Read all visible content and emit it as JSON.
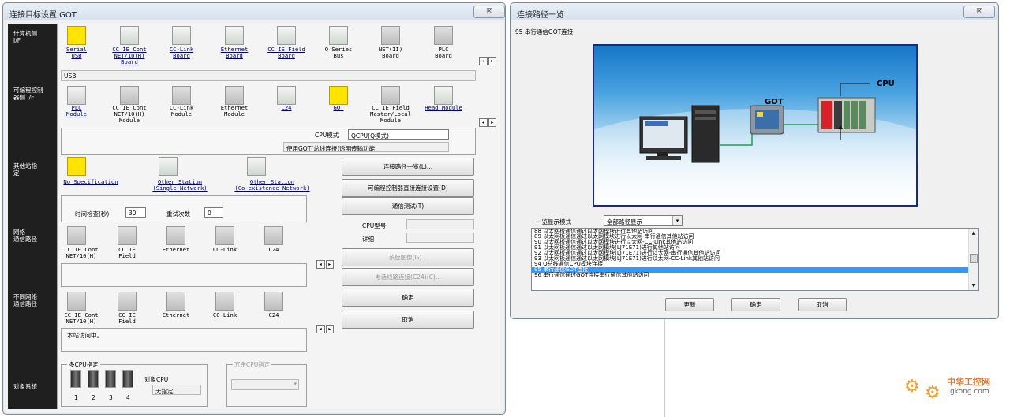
{
  "left_window": {
    "title": "连接目标设置 GOT",
    "close": "☒",
    "sections": {
      "computer_if": "计算机侧\nI/F",
      "plc_if": "可编程控制\n器侧 I/F",
      "other_station": "其他站指\n定",
      "network_route": "网络\n通信路径",
      "diff_network_route": "不同网络\n通信路径",
      "target_system": "对象系统"
    },
    "computer_if_items": [
      "Serial\nUSB",
      "CC IE Cont\nNET/10(H)\nBoard",
      "CC-Link\nBoard",
      "Ethernet\nBoard",
      "CC IE Field\nBoard",
      "Q Series\nBus",
      "NET(II)\nBoard",
      "PLC\nBoard"
    ],
    "computer_if_value": "USB",
    "plc_if_items": [
      "PLC\nModule",
      "CC IE Cont\nNET/10(H)\nModule",
      "CC-Link\nModule",
      "Ethernet\nModule",
      "C24",
      "GOT",
      "CC IE Field\nMaster/Local\nModule",
      "Head Module"
    ],
    "cpu_mode_label": "CPU模式",
    "cpu_mode_value": "QCPU(Q模式)",
    "transfer_text": "使用GOT(总线连接)透明传输功能",
    "other_station_items": [
      "No Specification",
      "Other Station\n(Single Network)",
      "Other Station\n(Co-existence Network)"
    ],
    "timeout_label": "时间检查(秒)",
    "timeout_value": "30",
    "retry_label": "重试次数",
    "retry_value": "0",
    "network_items": [
      "CC IE Cont\nNET/10(H)",
      "CC IE\nField",
      "Ethernet",
      "CC-Link",
      "C24"
    ],
    "diff_network_items": [
      "CC IE Cont\nNET/10(H)",
      "CC IE\nField",
      "Ethernet",
      "CC-Link",
      "C24"
    ],
    "status_text": "本站访问中。",
    "buttons": {
      "route_list": "连接路径一览(L)...",
      "plc_direct": "可编程控制器直接连接设置(D)",
      "comm_test": "通信测试(T)",
      "system_image": "系统图像(G)...",
      "phone_line": "电话线路连接(C24)(C)...",
      "ok": "确定",
      "cancel": "取消"
    },
    "cpu_type_label": "CPU型号",
    "detail_label": "详细",
    "multi_cpu_label": "多CPU指定",
    "cpu_numbers": [
      "1",
      "2",
      "3",
      "4"
    ],
    "target_cpu_label": "对象CPU",
    "target_cpu_value": "无指定",
    "redundant_label": "冗余CPU指定"
  },
  "right_window": {
    "title": "连接路径一览",
    "close": "☒",
    "selected_route": "95 串行通信GOT连接",
    "diagram": {
      "got_label": "GOT",
      "cpu_label": "CPU"
    },
    "display_mode_label": "一览显示模式",
    "display_mode_value": "全部路径显示",
    "routes": [
      "88 以太网板通信通过以太网模块进行其他站访问",
      "89 以太网板通信通过以太网模块进行以太网-串行通信其他站访问",
      "90 以太网板通信通过以太网模块进行以太网-CC-Link其他站访问",
      "91 以太网板通信通过以太网模块(LJ71E71)进行其他站访问",
      "92 以太网板通信通过以太网模块(LJ71E71)进行以太网-串行通信其他站访问",
      "93 以太网板通信通过以太网模块(LJ71E71)进行以太网-CC-Link其他站访问",
      "94 Q总线通信CPU模块连接",
      "95 串行通信GOT连接",
      "96 串行通信通过GOT连接串行通信其他站访问"
    ],
    "selected_index": 7,
    "buttons": {
      "refresh": "更新",
      "ok": "确定",
      "cancel": "取消"
    }
  },
  "watermark": {
    "text": "中华工控网",
    "url": "gkong.com"
  }
}
